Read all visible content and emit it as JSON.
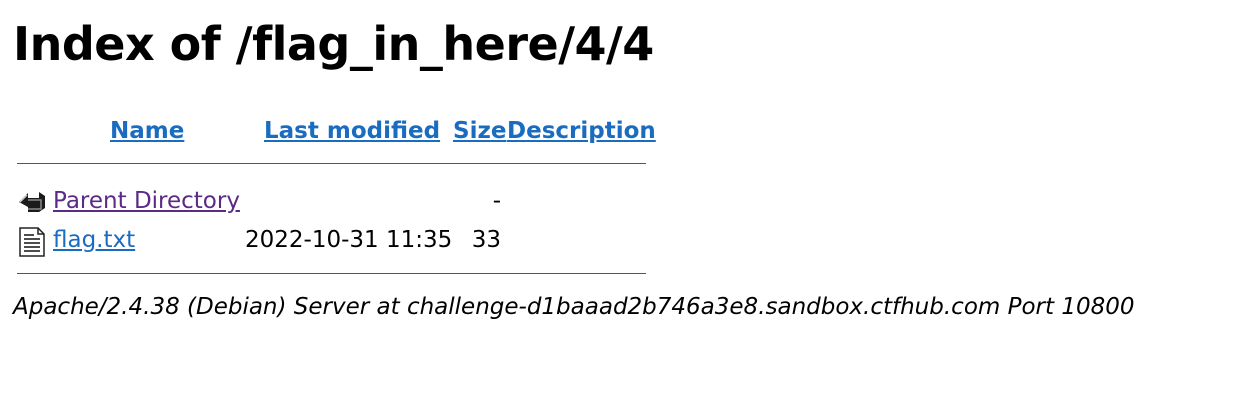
{
  "page": {
    "title": "Index of /flag_in_here/4/4"
  },
  "table": {
    "headers": {
      "name": "Name",
      "last_modified": "Last modified",
      "size": "Size",
      "description": "Description"
    },
    "rows": [
      {
        "icon": "back-arrow-icon",
        "name": "Parent Directory",
        "last_modified": "",
        "size": "-",
        "description": ""
      },
      {
        "icon": "text-file-icon",
        "name": "flag.txt",
        "last_modified": "2022-10-31 11:35",
        "size": "33",
        "description": ""
      }
    ]
  },
  "footer": {
    "server_signature": "Apache/2.4.38 (Debian) Server at challenge-d1baaad2b746a3e8.sandbox.ctfhub.com Port 10800"
  },
  "colors": {
    "link": "#1a6cc0",
    "visited_link": "#5b2a86",
    "text": "#000000",
    "background": "#ffffff"
  }
}
